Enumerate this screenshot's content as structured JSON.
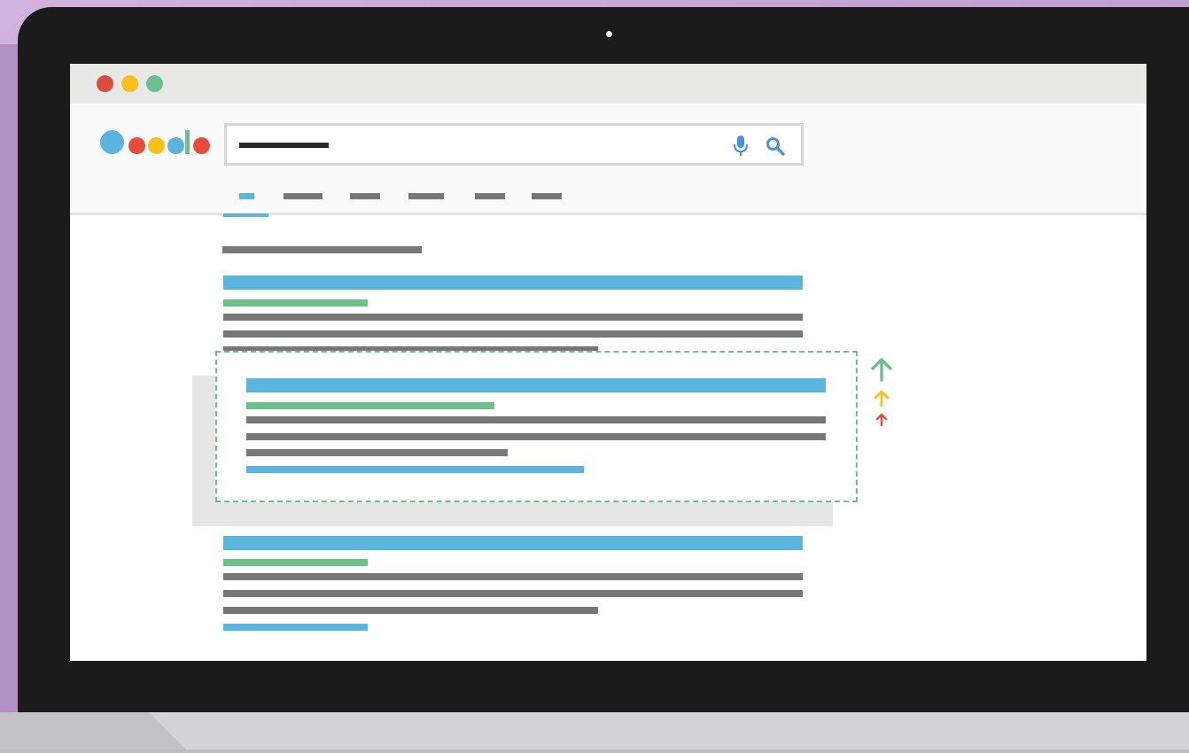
{
  "window": {
    "controls": [
      {
        "name": "close",
        "color": "#dd4b3e"
      },
      {
        "name": "minimize",
        "color": "#f7c11c"
      },
      {
        "name": "maximize",
        "color": "#6cc08b"
      }
    ]
  },
  "logo": {
    "colors": [
      "#5bb4de",
      "#e84a3c",
      "#f7c11c",
      "#5bb4de",
      "#6cc08b",
      "#e84a3c"
    ]
  },
  "search": {
    "icons": [
      "mic-icon",
      "search-icon"
    ],
    "mic_color": "#4a8fe7",
    "search_color": "#4a8fe7"
  },
  "tabs": [
    {
      "name": "tab-all",
      "active": true
    },
    {
      "name": "tab-2",
      "active": false
    },
    {
      "name": "tab-3",
      "active": false
    },
    {
      "name": "tab-4",
      "active": false
    },
    {
      "name": "tab-5",
      "active": false
    },
    {
      "name": "tab-6",
      "active": false
    }
  ],
  "results": [
    {
      "name": "result-1",
      "featured": false
    },
    {
      "name": "result-featured",
      "featured": true
    },
    {
      "name": "result-3",
      "featured": false
    }
  ],
  "ranking_arrows": [
    {
      "name": "arrow-up-large-icon",
      "color": "#6cc08b"
    },
    {
      "name": "arrow-up-medium-icon",
      "color": "#f7c11c"
    },
    {
      "name": "arrow-up-small-icon",
      "color": "#dd4b3e"
    }
  ],
  "colors": {
    "title": "#5bb4de",
    "url": "#6cc08b",
    "text": "#777777",
    "highlight_border": "#6cc08b"
  }
}
